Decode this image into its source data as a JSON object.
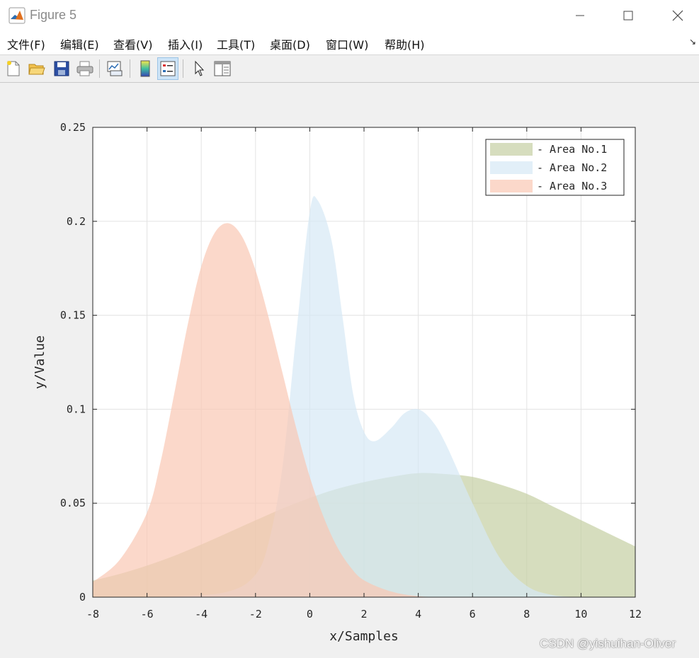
{
  "window": {
    "title": "Figure 5",
    "minimize_icon": "minimize-icon",
    "maximize_icon": "maximize-icon",
    "close_icon": "close-icon"
  },
  "menu": {
    "items": [
      {
        "label": "文件(F)"
      },
      {
        "label": "编辑(E)"
      },
      {
        "label": "查看(V)"
      },
      {
        "label": "插入(I)"
      },
      {
        "label": "工具(T)"
      },
      {
        "label": "桌面(D)"
      },
      {
        "label": "窗口(W)"
      },
      {
        "label": "帮助(H)"
      }
    ],
    "overflow_arrow": "↘"
  },
  "toolbar": {
    "buttons": [
      {
        "icon": "new-figure-icon"
      },
      {
        "icon": "open-file-icon"
      },
      {
        "icon": "save-icon"
      },
      {
        "icon": "print-icon"
      },
      {
        "icon": "link-plot-icon"
      },
      {
        "icon": "colorbar-icon"
      },
      {
        "icon": "legend-icon",
        "active": true
      },
      {
        "icon": "pointer-icon"
      },
      {
        "icon": "property-editor-icon"
      }
    ]
  },
  "chart_data": {
    "type": "area",
    "xlabel": "x/Samples",
    "ylabel": "y/Value",
    "xlim": [
      -8,
      12
    ],
    "ylim": [
      0,
      0.25
    ],
    "xticks": [
      -8,
      -6,
      -4,
      -2,
      0,
      2,
      4,
      6,
      8,
      10,
      12
    ],
    "xtick_labels": [
      "-8",
      "-6",
      "-4",
      "-2",
      "0",
      "2",
      "4",
      "6",
      "8",
      "10",
      "12"
    ],
    "yticks": [
      0,
      0.05,
      0.1,
      0.15,
      0.2,
      0.25
    ],
    "ytick_labels": [
      "0",
      "0.05",
      "0.1",
      "0.15",
      "0.2",
      "0.25"
    ],
    "grid": true,
    "legend_position": "top-right",
    "series": [
      {
        "name": "- Area No.1",
        "color": "#c5cfa3",
        "x": [
          -8,
          -7,
          -6,
          -5,
          -4,
          -3,
          -2,
          -1,
          0,
          1,
          2,
          3,
          4,
          5,
          6,
          7,
          8,
          9,
          10,
          11,
          12
        ],
        "y": [
          0.0088,
          0.0124,
          0.0168,
          0.022,
          0.028,
          0.0344,
          0.0409,
          0.0472,
          0.0528,
          0.0576,
          0.0612,
          0.064,
          0.066,
          0.0655,
          0.064,
          0.06,
          0.055,
          0.048,
          0.041,
          0.034,
          0.027
        ]
      },
      {
        "name": "- Area No.2",
        "color": "#d6e8f5",
        "x": [
          -8,
          -5,
          -3,
          -2,
          -1.5,
          -1,
          -0.5,
          0,
          0.3,
          0.8,
          1.2,
          1.6,
          2,
          2.4,
          3,
          3.5,
          4,
          4.5,
          5,
          6,
          7,
          8,
          9,
          10
        ],
        "y": [
          0,
          0.0003,
          0.003,
          0.012,
          0.03,
          0.07,
          0.14,
          0.205,
          0.211,
          0.19,
          0.15,
          0.108,
          0.088,
          0.083,
          0.09,
          0.098,
          0.1,
          0.094,
          0.082,
          0.05,
          0.021,
          0.006,
          0.001,
          0.0001
        ]
      },
      {
        "name": "- Area No.3",
        "color": "#f9c8b4",
        "x": [
          -8,
          -7,
          -6,
          -5.5,
          -5,
          -4.5,
          -4,
          -3.5,
          -3,
          -2.5,
          -2,
          -1.5,
          -1,
          -0.5,
          0,
          0.5,
          1,
          1.5,
          2,
          3,
          4,
          5
        ],
        "y": [
          0.008,
          0.02,
          0.045,
          0.072,
          0.108,
          0.145,
          0.176,
          0.194,
          0.199,
          0.192,
          0.174,
          0.148,
          0.119,
          0.09,
          0.064,
          0.043,
          0.027,
          0.016,
          0.009,
          0.003,
          0.0005,
          0
        ]
      }
    ]
  },
  "watermark": "CSDN @yishuihan-Oliver"
}
